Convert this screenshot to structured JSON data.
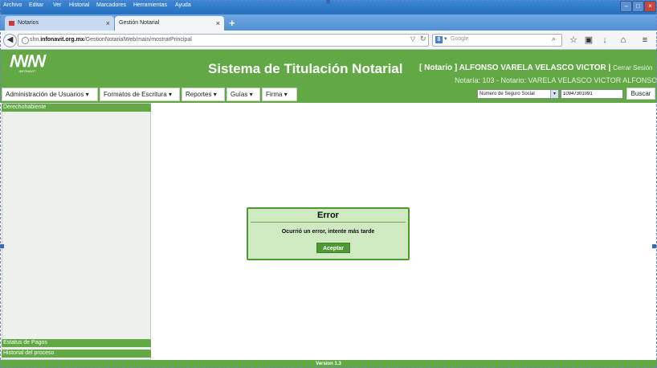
{
  "browser": {
    "menu": [
      "Archivo",
      "Editar",
      "Ver",
      "Historial",
      "Marcadores",
      "Herramientas",
      "Ayuda"
    ],
    "tabs": [
      {
        "label": "Notarios",
        "close": "×"
      },
      {
        "label": "Gestión Notarial",
        "close": "×"
      }
    ],
    "new_tab": "+",
    "url_prefix": "shn.",
    "url_host": "infonavit.org.mx",
    "url_path": "/GestionNotarialWeb/main/mostrarPrincipal",
    "search_engine_placeholder": "Google",
    "window_buttons": [
      "–",
      "□",
      "×"
    ]
  },
  "app": {
    "logo_text": "INFONAVIT",
    "title": "Sistema de Titulación Notarial",
    "user_line": "[ Notario ] ALFONSO VARELA VELASCO VICTOR |",
    "logout": "Cerrar Sesión",
    "notaria_line": "Notaría: 103 - Notario: VARELA VELASCO VICTOR ALFONSO"
  },
  "menubar": {
    "items": [
      {
        "label": "Administración de Usuarios"
      },
      {
        "label": "Formatos de Escritura"
      },
      {
        "label": "Reportes"
      },
      {
        "label": "Guías"
      },
      {
        "label": "Firma"
      }
    ],
    "search_type": "Número de Seguro Social",
    "search_value": "10947301091",
    "search_button": "Buscar"
  },
  "sidebar": {
    "panels": [
      "Derechohabiente",
      "Estatus de Pagos",
      "Historial del proceso"
    ]
  },
  "dialog": {
    "title": "Error",
    "message": "Ocurrió un error, intente más tarde",
    "ok_label": "Aceptar"
  },
  "footer": {
    "version": "Version 1.3"
  },
  "colors": {
    "brand_green": "#62a845",
    "dialog_bg": "#cfeac0",
    "dialog_border": "#4d9a35"
  }
}
